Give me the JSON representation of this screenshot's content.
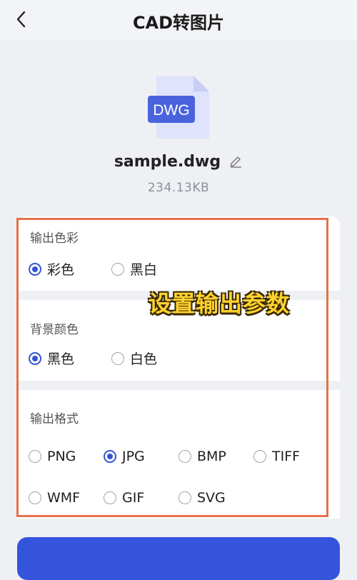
{
  "header": {
    "title": "CAD转图片"
  },
  "file": {
    "icon_text": "DWG",
    "name": "sample.dwg",
    "size": "234.13KB"
  },
  "sections": {
    "output_color": {
      "label": "输出色彩",
      "options": [
        "彩色",
        "黑白"
      ],
      "selected": "彩色"
    },
    "background_color": {
      "label": "背景颜色",
      "options": [
        "黑色",
        "白色"
      ],
      "selected": "黑色"
    },
    "output_format": {
      "label": "输出格式",
      "options": [
        "PNG",
        "JPG",
        "BMP",
        "TIFF",
        "WMF",
        "GIF",
        "SVG"
      ],
      "selected": "JPG"
    }
  },
  "annotation": {
    "text": "设置输出参数"
  },
  "colors": {
    "accent": "#3454d1",
    "highlight_border": "#e4714a",
    "overlay_text": "#ffd22e"
  },
  "icons": [
    "back-arrow-icon",
    "dwg-file-icon",
    "edit-pencil-icon"
  ]
}
